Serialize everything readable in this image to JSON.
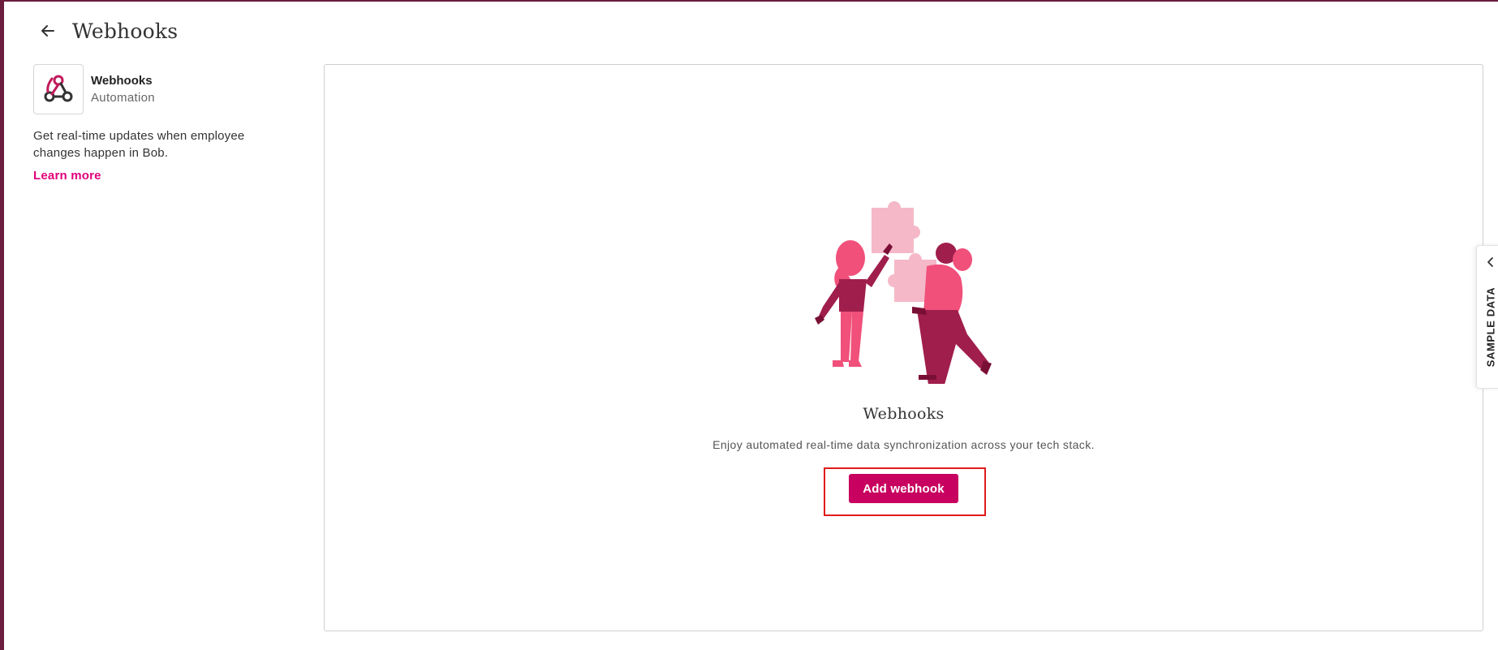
{
  "header": {
    "title": "Webhooks",
    "back_icon": "arrow-left-icon"
  },
  "sidebar": {
    "app_name": "Webhooks",
    "app_category": "Automation",
    "app_logo_icon": "webhook-icon",
    "description": "Get real-time updates when employee changes happen in Bob.",
    "learn_more_label": "Learn more"
  },
  "main": {
    "illustration_icon": "puzzle-people-illustration",
    "empty_title": "Webhooks",
    "empty_description": "Enjoy automated real-time data synchronization across your tech stack.",
    "add_button_label": "Add webhook"
  },
  "side_tab": {
    "label": "SAMPLE DATA",
    "chevron_icon": "chevron-left-icon"
  },
  "colors": {
    "accent": "#e0007a",
    "primary_button": "#c8005f",
    "frame": "#6b1d3e",
    "highlight": "#e01b1b"
  }
}
